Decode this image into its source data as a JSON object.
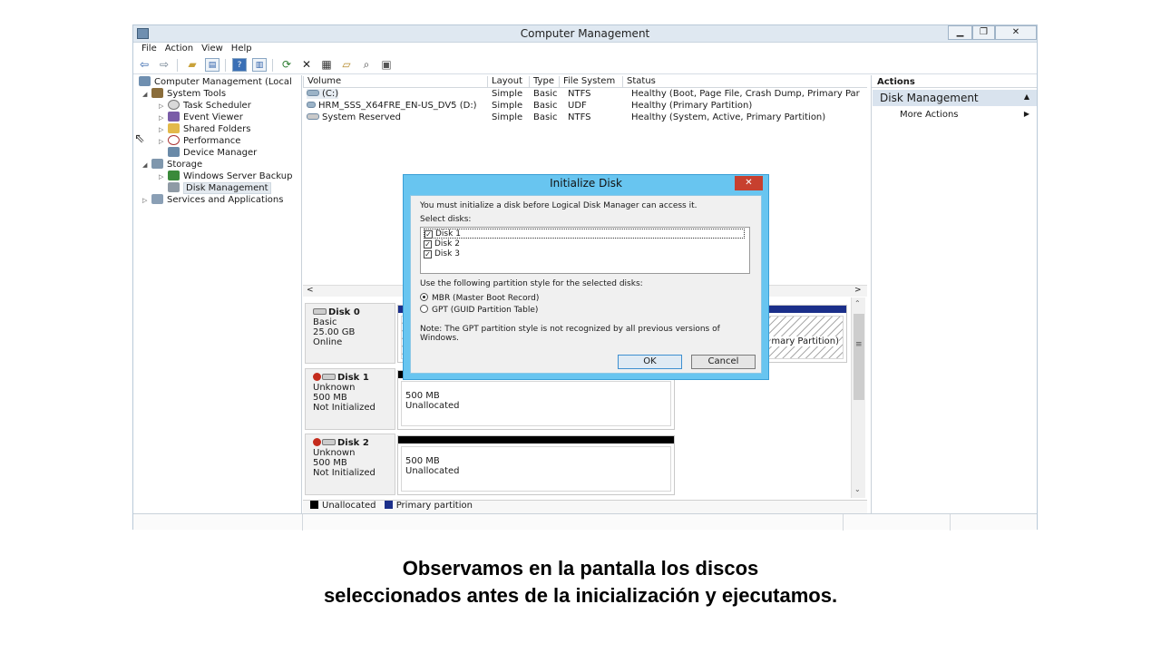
{
  "window": {
    "title": "Computer Management",
    "controls": {
      "min": "▁",
      "max": "❐",
      "close": "✕"
    }
  },
  "menu": [
    "File",
    "Action",
    "View",
    "Help"
  ],
  "tree": [
    {
      "label": "Computer Management (Local",
      "indent": 0,
      "arrow": "",
      "icon": "computer-management-icon",
      "color": "#6f8fb0"
    },
    {
      "label": "System Tools",
      "indent": 1,
      "arrow": "◢",
      "icon": "system-tools-icon",
      "color": "#8a6d3b"
    },
    {
      "label": "Task Scheduler",
      "indent": 2,
      "arrow": "▷",
      "icon": "task-scheduler-icon",
      "color": "#b7b7b7"
    },
    {
      "label": "Event Viewer",
      "indent": 2,
      "arrow": "▷",
      "icon": "event-viewer-icon",
      "color": "#7a5ca8"
    },
    {
      "label": "Shared Folders",
      "indent": 2,
      "arrow": "▷",
      "icon": "shared-folders-icon",
      "color": "#e3b94a"
    },
    {
      "label": "Performance",
      "indent": 2,
      "arrow": "▷",
      "icon": "performance-icon",
      "color": "#a33"
    },
    {
      "label": "Device Manager",
      "indent": 2,
      "arrow": "",
      "icon": "device-manager-icon",
      "color": "#6a8aa8"
    },
    {
      "label": "Storage",
      "indent": 1,
      "arrow": "◢",
      "icon": "storage-icon",
      "color": "#7f97ad"
    },
    {
      "label": "Windows Server Backup",
      "indent": 2,
      "arrow": "▷",
      "icon": "windows-server-backup-icon",
      "color": "#3a8a3a"
    },
    {
      "label": "Disk Management",
      "indent": 2,
      "arrow": "",
      "icon": "disk-management-icon",
      "color": "#8f9aa5",
      "selected": true
    },
    {
      "label": "Services and Applications",
      "indent": 1,
      "arrow": "▷",
      "icon": "services-and-applications-icon",
      "color": "#8a9fb5",
      "noicon_indent": true
    }
  ],
  "volumes": {
    "columns": [
      "Volume",
      "Layout",
      "Type",
      "File System",
      "Status"
    ],
    "rows": [
      {
        "name": "(C:)",
        "layout": "Simple",
        "type": "Basic",
        "fs": "NTFS",
        "status": "Healthy (Boot, Page File, Crash Dump, Primary Par"
      },
      {
        "name": "HRM_SSS_X64FRE_EN-US_DV5 (D:)",
        "layout": "Simple",
        "type": "Basic",
        "fs": "UDF",
        "status": "Healthy (Primary Partition)"
      },
      {
        "name": "System Reserved",
        "layout": "Simple",
        "type": "Basic",
        "fs": "NTFS",
        "status": "Healthy (System, Active, Primary Partition)"
      }
    ]
  },
  "disks": [
    {
      "name": "Disk 0",
      "lines": [
        "Basic",
        "25.00 GB",
        "Online"
      ],
      "partition_text": "mary Partition)"
    },
    {
      "name": "Disk 1",
      "lines": [
        "Unknown",
        "500 MB",
        "Not Initialized"
      ],
      "size": "500 MB",
      "state": "Unallocated"
    },
    {
      "name": "Disk 2",
      "lines": [
        "Unknown",
        "500 MB",
        "Not Initialized"
      ],
      "size": "500 MB",
      "state": "Unallocated"
    }
  ],
  "legend": {
    "unallocated": "Unallocated",
    "primary": "Primary partition",
    "unallocated_color": "#000000",
    "primary_color": "#1b2f8a"
  },
  "actions": {
    "header": "Actions",
    "section": "Disk Management",
    "more": "More Actions"
  },
  "dialog": {
    "title": "Initialize Disk",
    "close": "✕",
    "intro": "You must initialize a disk before Logical Disk Manager can access it.",
    "select_label": "Select disks:",
    "disks": [
      {
        "label": "Disk 1",
        "checked": true
      },
      {
        "label": "Disk 2",
        "checked": true
      },
      {
        "label": "Disk 3",
        "checked": true
      }
    ],
    "style_label": "Use the following partition style for the selected disks:",
    "mbr": "MBR (Master Boot Record)",
    "gpt": "GPT (GUID Partition Table)",
    "selected_style": "MBR",
    "note_line1": "Note: The GPT partition style is not recognized by all previous versions of",
    "note_line2": "Windows.",
    "ok": "OK",
    "cancel": "Cancel"
  },
  "caption": {
    "line1": "Observamos en la pantalla los discos",
    "line2": "seleccionados antes de la inicialización y ejecutamos."
  }
}
